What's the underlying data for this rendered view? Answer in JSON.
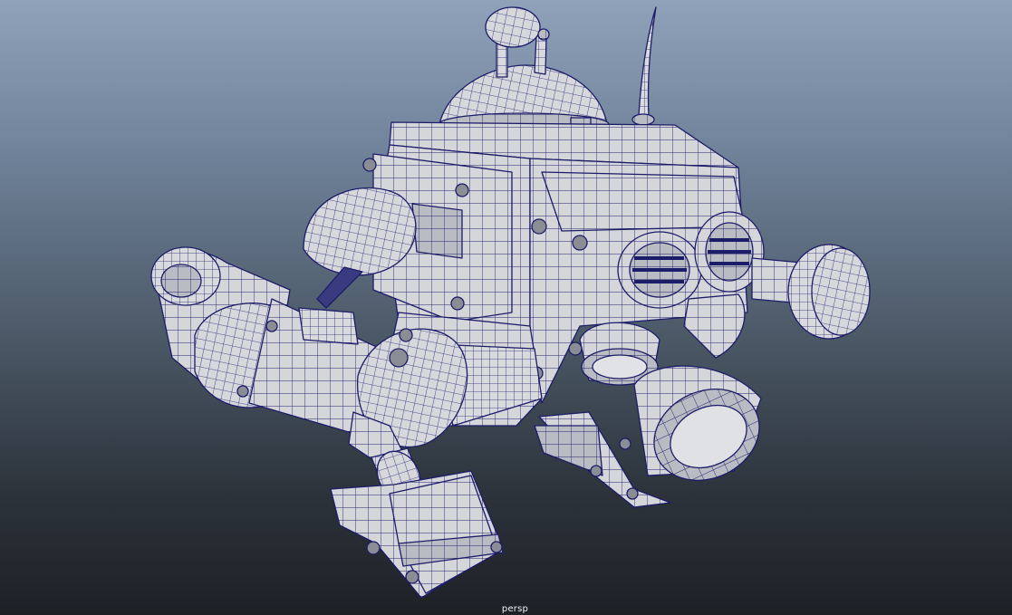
{
  "viewport": {
    "camera_label": "persp",
    "display_mode": "wireframe-on-shaded",
    "background_top": "#8fa2ba",
    "background_bottom": "#1d2126",
    "mesh_fill": "#d4d6da",
    "wire_color": "#1a1a6e"
  },
  "model": {
    "subject": "robot"
  }
}
